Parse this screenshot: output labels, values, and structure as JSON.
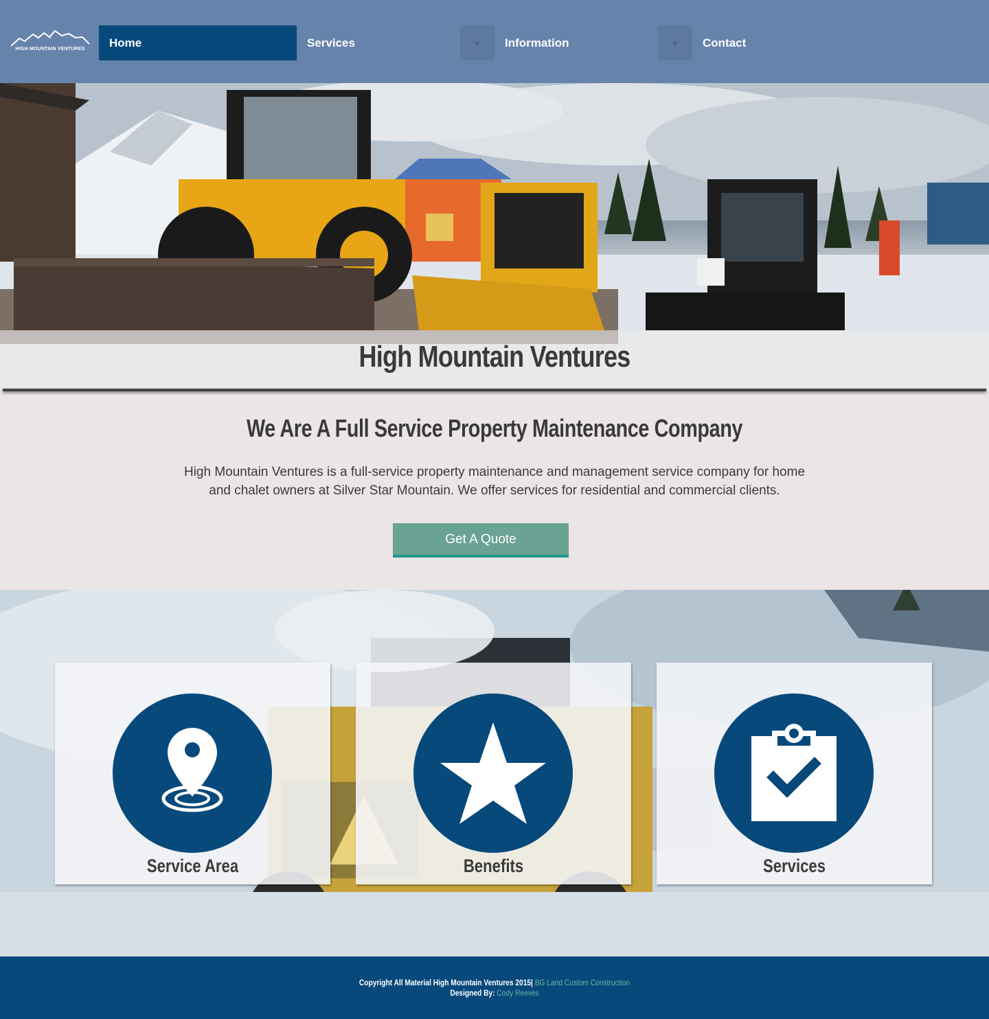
{
  "brand": {
    "logo_text": "HIGH MOUNTAIN VENTURES"
  },
  "nav": {
    "items": [
      {
        "label": "Home",
        "active": true
      },
      {
        "label": "Services"
      },
      {
        "label": "Information"
      },
      {
        "label": "Contact"
      }
    ],
    "dropdown_glyph": "▼"
  },
  "hero": {
    "title": "High Mountain Ventures"
  },
  "intro": {
    "heading": "We Are A Full Service Property Maintenance Company",
    "text": "High Mountain Ventures is a full-service property maintenance and management service company for home and chalet owners at Silver Star Mountain. We offer services for residential and commercial clients.",
    "button_label": "Get A Quote"
  },
  "features": [
    {
      "label": "Service Area",
      "icon": "map-pin-icon"
    },
    {
      "label": "Benefits",
      "icon": "star-icon"
    },
    {
      "label": "Services",
      "icon": "clipboard-check-icon"
    }
  ],
  "footer": {
    "copyright": "Copyright All Material High Mountain Ventures 2015|",
    "copyright_link": "BG Land Custom Construction",
    "designed_by_label": "Designed By:",
    "designer_link": "Cody Reeves"
  },
  "colors": {
    "nav_bg": "#6683ab",
    "primary": "#07497b",
    "button": "#6aa293",
    "link": "#6fb3a4",
    "page_bg": "#ebe5e5"
  }
}
